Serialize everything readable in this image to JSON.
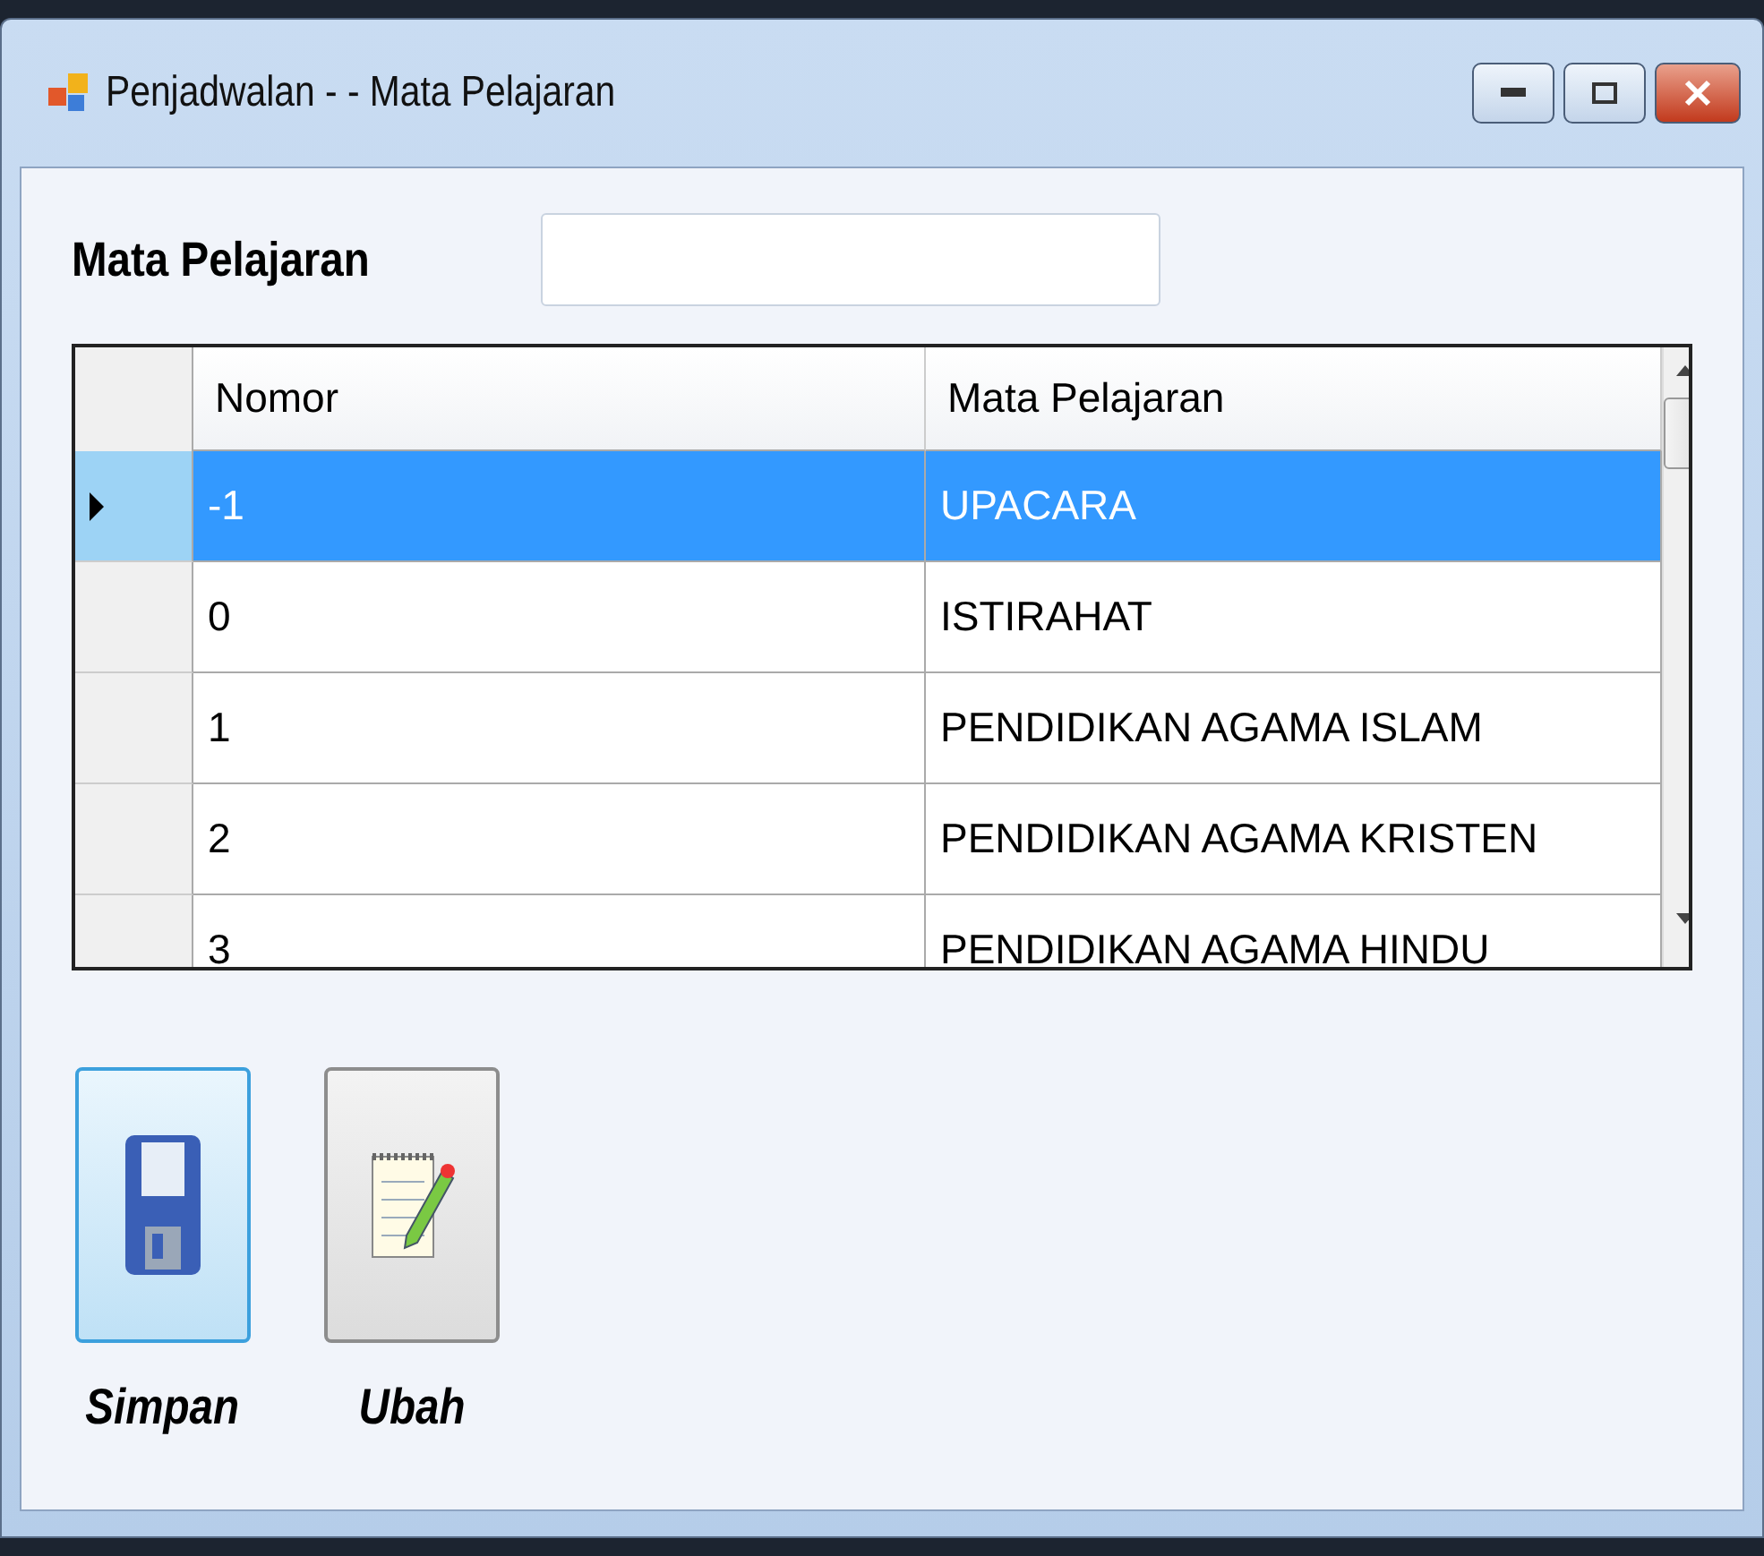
{
  "window": {
    "title": "Penjadwalan - - Mata Pelajaran"
  },
  "field": {
    "label": "Mata Pelajaran"
  },
  "table": {
    "columns": [
      "Nomor",
      "Mata Pelajaran"
    ],
    "rows": [
      {
        "cells": [
          "-1",
          "UPACARA"
        ],
        "selected": true
      },
      {
        "cells": [
          "0",
          "ISTIRAHAT"
        ],
        "selected": false
      },
      {
        "cells": [
          "1",
          "PENDIDIKAN AGAMA ISLAM"
        ],
        "selected": false
      },
      {
        "cells": [
          "2",
          "PENDIDIKAN AGAMA KRISTEN"
        ],
        "selected": false
      },
      {
        "cells": [
          "3",
          "PENDIDIKAN AGAMA HINDU"
        ],
        "selected": false
      }
    ]
  },
  "buttons": [
    {
      "kind": "save",
      "label": "Simpan",
      "selected": true
    },
    {
      "kind": "edit",
      "label": "Ubah",
      "selected": false
    }
  ]
}
